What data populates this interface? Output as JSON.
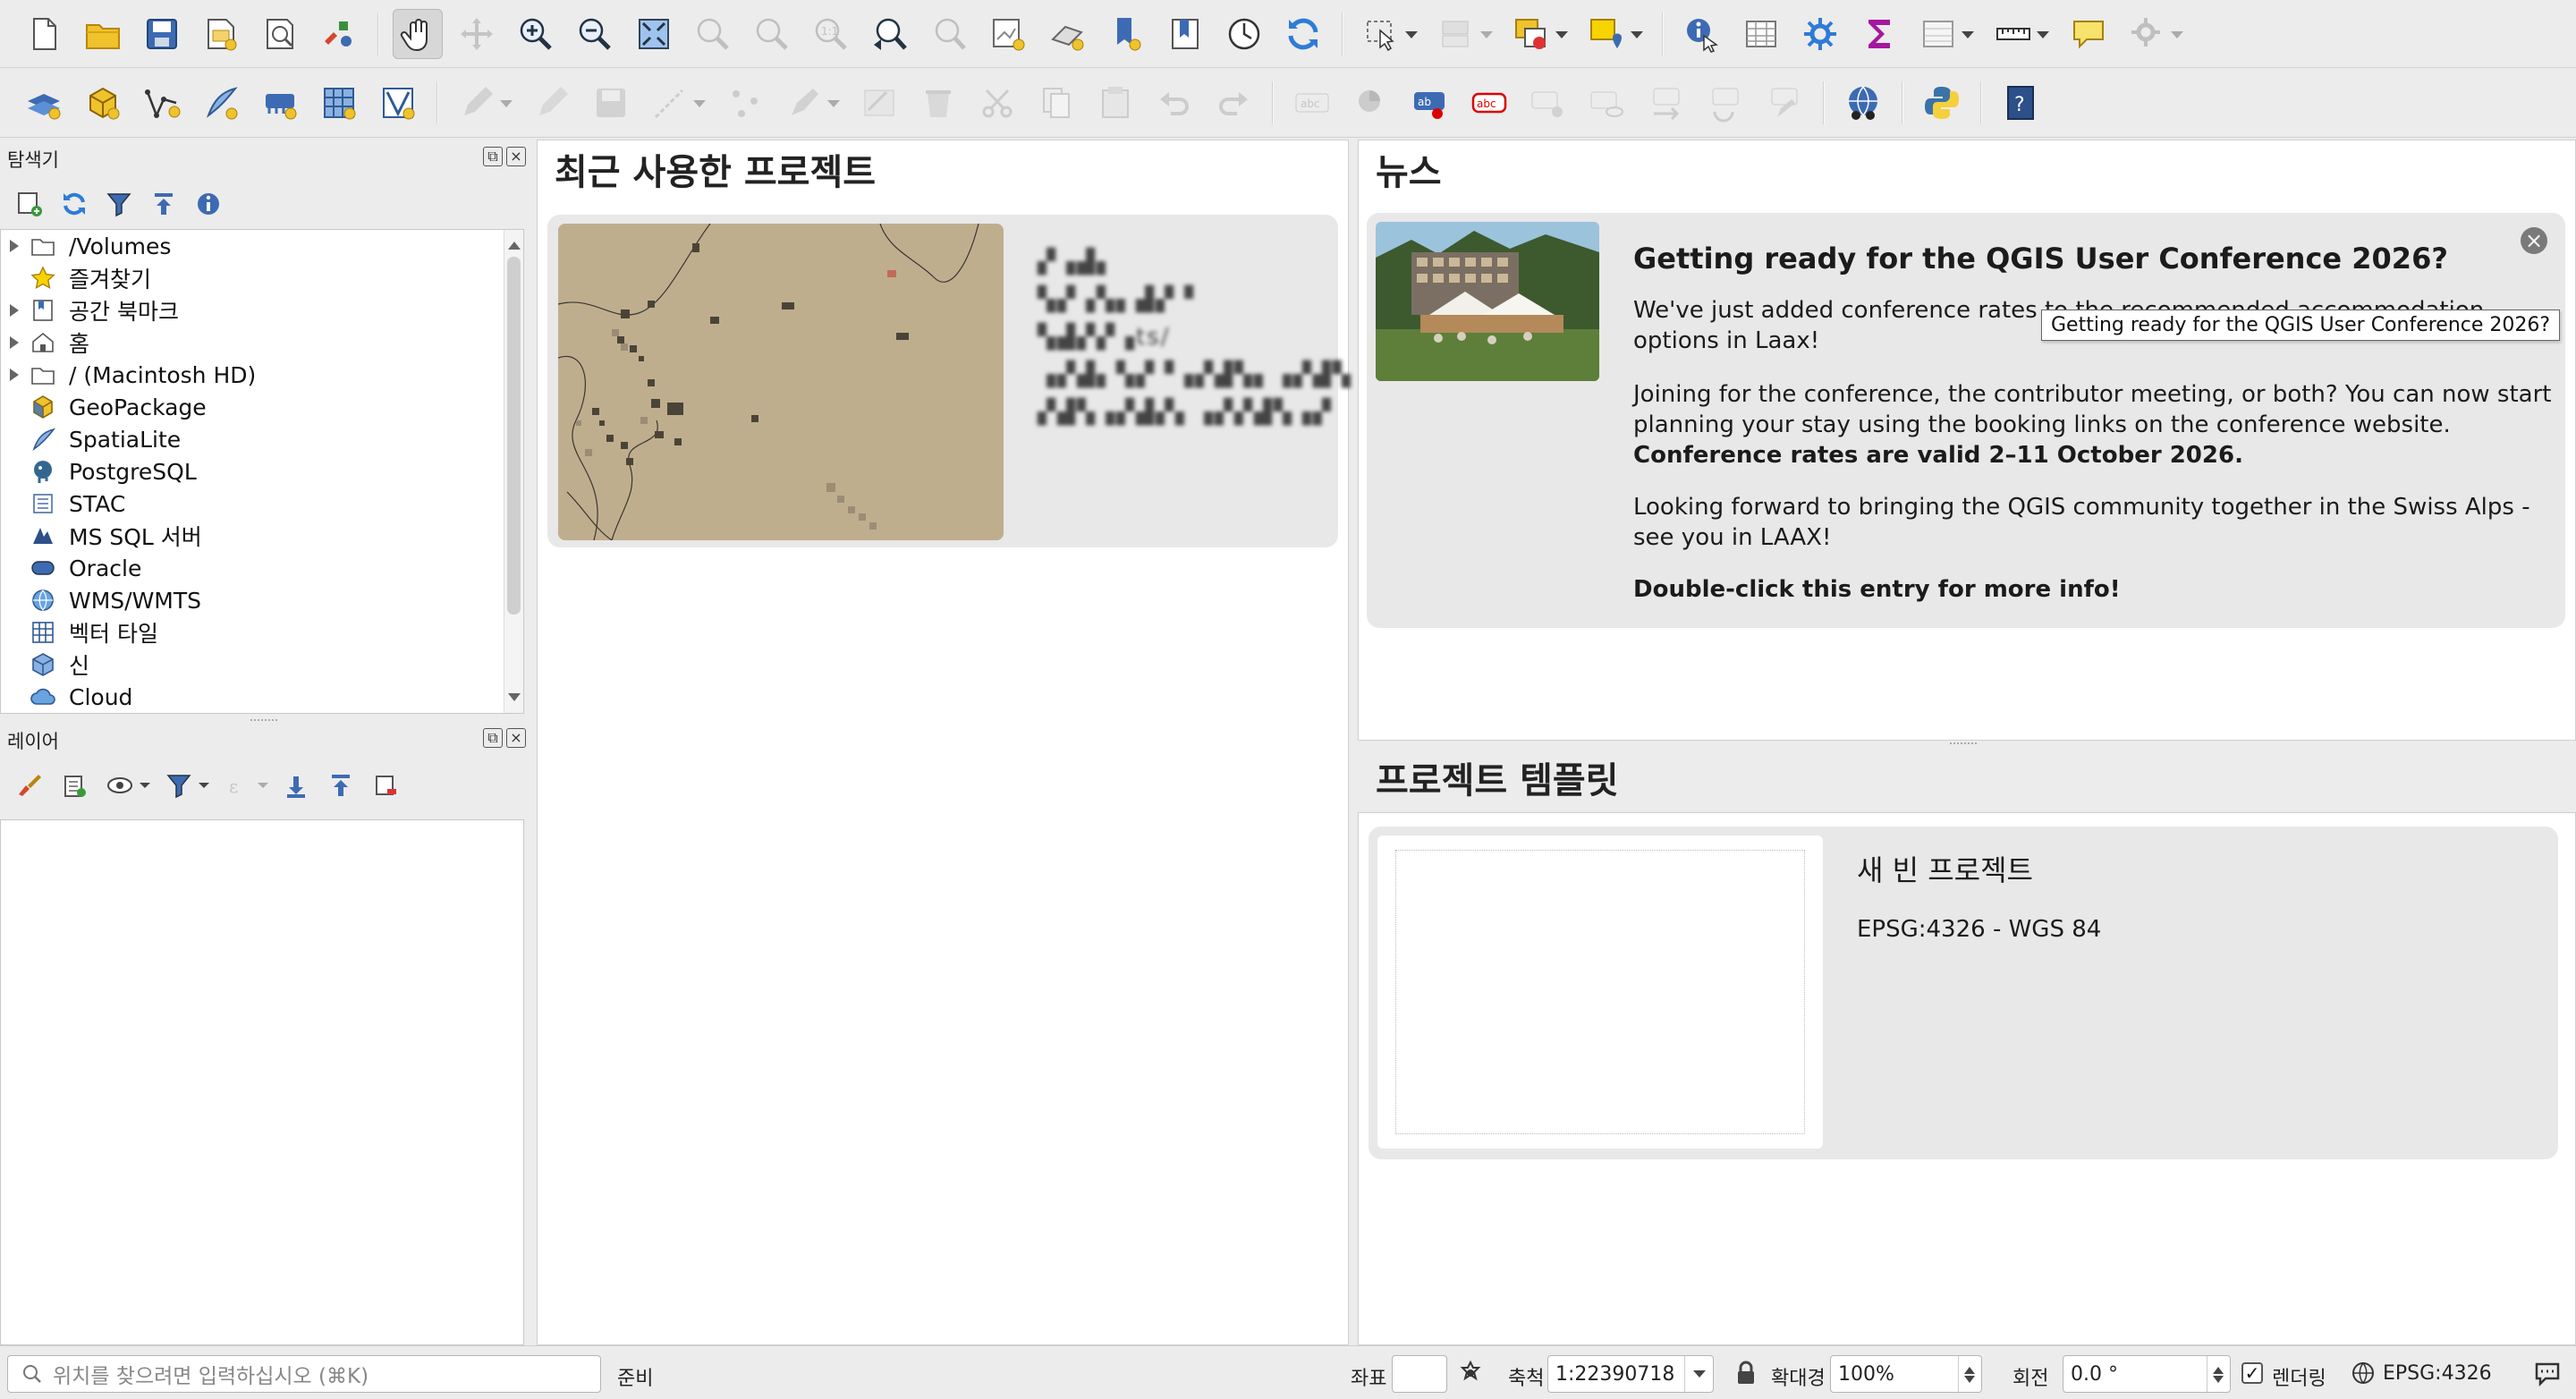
{
  "toolbar_main": {
    "groups": [
      [
        "new-project-icon",
        "open-project-icon",
        "save-project-icon",
        "new-print-layout-icon",
        "layout-manager-icon",
        "style-manager-icon"
      ],
      [
        "pan-map-icon",
        "pan-to-selection-icon",
        "zoom-in-icon",
        "zoom-out-icon",
        "zoom-full-icon",
        "zoom-to-selection-icon",
        "zoom-to-layer-icon",
        "zoom-native-icon",
        "zoom-last-icon",
        "zoom-next-icon",
        "new-map-view-icon",
        "new-3d-map-view-icon",
        "new-bookmark-icon",
        "show-bookmarks-icon",
        "temporal-controller-icon",
        "refresh-icon"
      ],
      [
        "select-features-icon",
        "deselect-features-icon",
        "select-by-location-icon",
        "add-annotation-icon"
      ],
      [
        "identify-features-icon",
        "attribute-table-icon",
        "processing-toolbox-icon",
        "statistics-sum-icon",
        "open-field-calculator-icon",
        "measure-line-icon",
        "map-tips-icon",
        "settings-gear-icon"
      ]
    ]
  },
  "toolbar_secondary": {
    "groups": [
      [
        "data-source-manager-icon",
        "new-geopackage-layer-icon",
        "new-shapefile-layer-icon",
        "new-spatialite-layer-icon",
        "new-temporary-layer-icon",
        "new-virtual-layer-icon",
        "new-mesh-layer-icon"
      ],
      [
        "current-edits-icon",
        "toggle-editing-icon",
        "save-edits-icon",
        "digitize-icon",
        "vertex-tool-icon",
        "modify-attributes-icon",
        "delete-selected-icon",
        "cut-features-icon",
        "copy-features-icon",
        "paste-features-icon",
        "undo-icon",
        "redo-icon"
      ],
      [
        "layer-labeling-icon",
        "layer-diagram-icon",
        "label-highlight-icon",
        "label-rule-icon",
        "pin-labels-icon",
        "show-hide-labels-icon",
        "move-label-icon",
        "rotate-label-icon",
        "change-label-icon"
      ],
      [
        "network-plugin-icon",
        "python-console-icon",
        "help-icon"
      ]
    ]
  },
  "browser_panel": {
    "title": "탐색기",
    "tools": [
      "add-layer-icon",
      "refresh-icon",
      "filter-icon",
      "collapse-all-icon",
      "properties-info-icon"
    ],
    "items": [
      {
        "label": "/Volumes",
        "icon": "folder-icon",
        "expandable": true
      },
      {
        "label": "즐겨찾기",
        "icon": "star-icon",
        "expandable": false
      },
      {
        "label": "공간 북마크",
        "icon": "bookmark-icon",
        "expandable": true
      },
      {
        "label": "홈",
        "icon": "home-icon",
        "expandable": true
      },
      {
        "label": "/ (Macintosh HD)",
        "icon": "folder-icon",
        "expandable": true
      },
      {
        "label": "GeoPackage",
        "icon": "geopackage-icon",
        "expandable": false
      },
      {
        "label": "SpatiaLite",
        "icon": "spatialite-icon",
        "expandable": false
      },
      {
        "label": "PostgreSQL",
        "icon": "postgresql-icon",
        "expandable": false
      },
      {
        "label": "STAC",
        "icon": "stac-icon",
        "expandable": false
      },
      {
        "label": "MS SQL 서버",
        "icon": "mssql-icon",
        "expandable": false
      },
      {
        "label": "Oracle",
        "icon": "oracle-icon",
        "expandable": false
      },
      {
        "label": "WMS/WMTS",
        "icon": "wms-icon",
        "expandable": false
      },
      {
        "label": "벡터 타일",
        "icon": "vector-tile-icon",
        "expandable": false
      },
      {
        "label": "신",
        "icon": "scene-icon",
        "expandable": false
      },
      {
        "label": "Cloud",
        "icon": "cloud-icon",
        "expandable": false
      }
    ]
  },
  "layers_panel": {
    "title": "레이어",
    "tools": [
      "style-layers-icon",
      "add-group-icon",
      "manage-visibility-icon",
      "filter-legend-icon",
      "filter-expression-icon",
      "expand-all-icon",
      "collapse-all-icon",
      "remove-layer-icon"
    ]
  },
  "recent_projects": {
    "title": "최근 사용한 프로젝트",
    "item": {
      "line1": "▞▗▟▖",
      "line2": "▚▞▗▚▖▟▞▝ ▚▟▞▞▗ts/",
      "line3": "▗▞▟▖▚▞▝▗▞▟▚▖▗▞▟▚",
      "line4": "▞▟▚▗▞▟▞▖▗▞▞▟▚▗▞"
    }
  },
  "news": {
    "title": "뉴스",
    "heading": "Getting ready for the QGIS User Conference 2026?",
    "paragraph1": "We've just added conference rates to the recommended accommodation options in Laax!",
    "paragraph2": "Joining for the conference, the contributor meeting, or both? You can now start planning your stay using the booking links on the conference website.",
    "paragraph2_bold": "Conference rates are valid 2–11 October 2026.",
    "paragraph3": "Looking forward to bringing the QGIS community together in the Swiss Alps - see you in LAAX!",
    "cta": "Double-click this entry for more info!",
    "tooltip": "Getting ready for the QGIS User Conference 2026?",
    "close": "×"
  },
  "templates": {
    "title": "프로젝트 템플릿",
    "item_name": "새 빈 프로젝트",
    "item_crs": "EPSG:4326 - WGS 84"
  },
  "statusbar": {
    "locator_placeholder": "위치를 찾으려면 입력하십시오 (⌘K)",
    "status": "준비",
    "coord_label": "좌표",
    "coord_value": "",
    "scale_label": "축척",
    "scale_value": "1:22390718",
    "magnifier_label": "확대경",
    "magnifier_value": "100%",
    "rotation_label": "회전",
    "rotation_value": "0.0 °",
    "render_label": "렌더링",
    "render_checked": "✓",
    "crs": "EPSG:4326"
  }
}
